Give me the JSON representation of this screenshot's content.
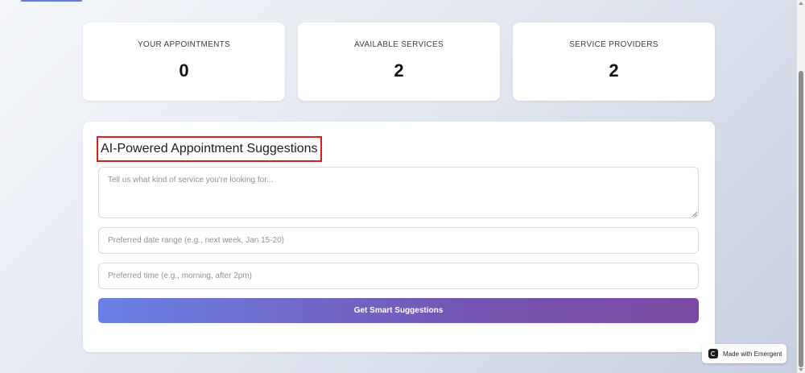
{
  "stats": [
    {
      "label": "YOUR APPOINTMENTS",
      "value": "0"
    },
    {
      "label": "AVAILABLE SERVICES",
      "value": "2"
    },
    {
      "label": "SERVICE PROVIDERS",
      "value": "2"
    }
  ],
  "ai_panel": {
    "title": "AI-Powered Appointment Suggestions",
    "highlight_color": "#e01b1b",
    "service_placeholder": "Tell us what kind of service you're looking for...",
    "date_placeholder": "Preferred date range (e.g., next week, Jan 15-20)",
    "time_placeholder": "Preferred time (e.g., morning, after 2pm)",
    "button_label": "Get Smart Suggestions",
    "button_gradient": [
      "#6a80e6",
      "#7a4aa3"
    ]
  },
  "badge": {
    "icon": "emergent-logo-icon",
    "text": "Made with Emergent"
  },
  "colors": {
    "background": "#e3e8f1",
    "card": "#ffffff",
    "accent": "#5b7be6"
  }
}
